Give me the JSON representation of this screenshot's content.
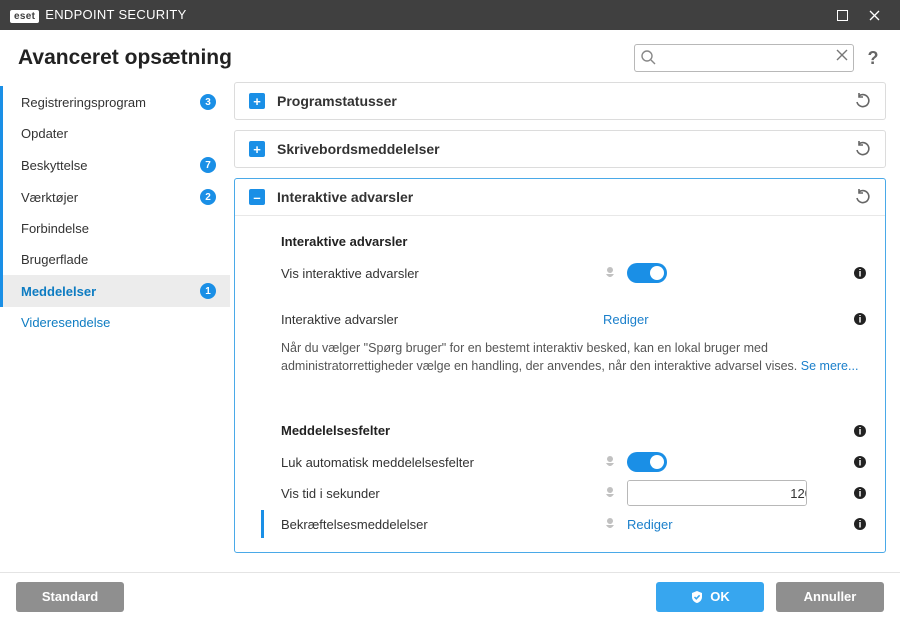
{
  "app": {
    "brand_tag": "eset",
    "product": "ENDPOINT SECURITY"
  },
  "page_title": "Avanceret opsætning",
  "search": {
    "value": "",
    "placeholder": ""
  },
  "sidebar": [
    {
      "label": "Registreringsprogram",
      "badge": "3",
      "group_head": true
    },
    {
      "label": "Opdater",
      "group_head": true
    },
    {
      "label": "Beskyttelse",
      "badge": "7",
      "group_head": true
    },
    {
      "label": "Værktøjer",
      "badge": "2",
      "group_head": true
    },
    {
      "label": "Forbindelse",
      "group_head": true
    },
    {
      "label": "Brugerflade",
      "group_head": true
    },
    {
      "label": "Meddelelser",
      "badge": "1",
      "active": true,
      "accented": true
    },
    {
      "label": "Videresendelse",
      "accented": true
    }
  ],
  "panels": {
    "program_statuses": {
      "title": "Programstatusser"
    },
    "desktop_notifications": {
      "title": "Skrivebordsmeddelelser"
    },
    "interactive_alerts": {
      "title": "Interaktive advarsler",
      "section1_heading": "Interaktive advarsler",
      "show_alerts_label": "Vis interaktive advarsler",
      "show_alerts_on": true,
      "edit_alerts_label": "Interaktive advarsler",
      "edit_link": "Rediger",
      "description": "Når du vælger \"Spørg bruger\" for en bestemt interaktiv besked, kan en lokal bruger med administratorrettigheder vælge en handling, der anvendes, når den interaktive advarsel vises.",
      "see_more": "Se mere...",
      "section2_heading": "Meddelelsesfelter",
      "auto_close_label": "Luk automatisk meddelelsesfelter",
      "auto_close_on": true,
      "show_time_label": "Vis tid i sekunder",
      "show_time_value": "120",
      "confirm_label": "Bekræftelsesmeddelelser",
      "confirm_link": "Rediger"
    }
  },
  "footer": {
    "default": "Standard",
    "ok": "OK",
    "cancel": "Annuller"
  }
}
